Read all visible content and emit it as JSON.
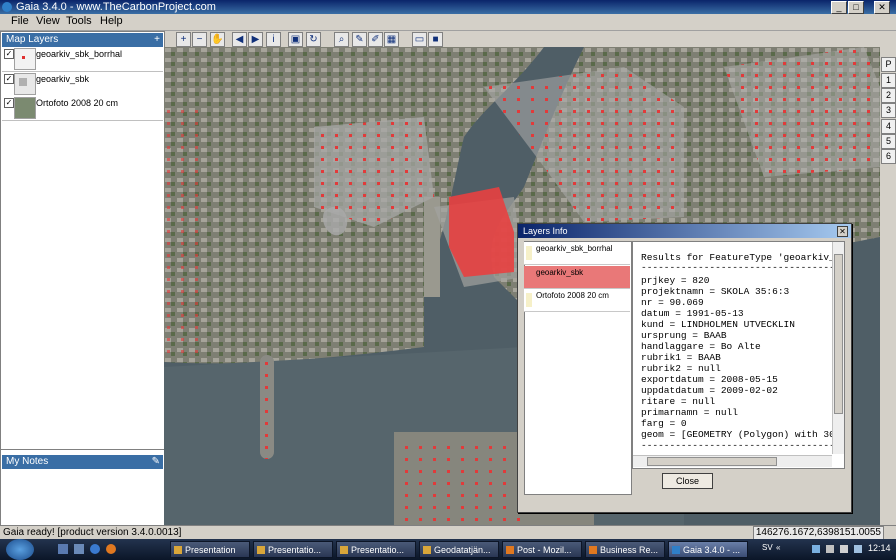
{
  "window": {
    "title": "Gaia 3.4.0 - www.TheCarbonProject.com"
  },
  "menu": [
    "File",
    "View",
    "Tools",
    "Help"
  ],
  "toolbar": {
    "icons": [
      "zoom-in-icon",
      "zoom-out-icon",
      "pan-icon",
      "back-icon",
      "forward-icon",
      "info-icon",
      "zoom-extent-icon",
      "refresh-icon",
      "select-icon",
      "edit-icon",
      "draw-icon",
      "table-icon",
      "open-folder-icon",
      "save-icon"
    ]
  },
  "map_layers": {
    "header": "Map Layers",
    "items": [
      {
        "label": "geoarkiv_sbk_borrhal",
        "checked": true
      },
      {
        "label": "geoarkiv_sbk",
        "checked": true
      },
      {
        "label": "Ortofoto 2008 20 cm",
        "checked": true
      }
    ]
  },
  "notes": {
    "header": "My Notes"
  },
  "scale_buttons": [
    "P",
    "1",
    "2",
    "3",
    "4",
    "5",
    "6"
  ],
  "dialog": {
    "title": "Layers Info",
    "layers": [
      "geoarkiv_sbk_borrhal",
      "geoarkiv_sbk",
      "Ortofoto 2008 20 cm"
    ],
    "selected_layer": "geoarkiv_sbk",
    "results": [
      "Results for FeatureType 'geoarkiv_s",
      "---------------------------------------",
      "prjkey = 820",
      "projektnamn = SKOLA 35:6:3",
      "nr = 90.069",
      "datum = 1991-05-13",
      "kund = LINDHOLMEN UTVECKLIN",
      "ursprung = BAAB",
      "handlaggare = Bo Alte",
      "rubrik1 = BAAB",
      "rubrik2 = null",
      "exportdatum = 2008-05-15",
      "uppdatdatum = 2009-02-02",
      "ritare = null",
      "primarnamn = null",
      "farg = 0",
      "geom = [GEOMETRY (Polygon) with 30",
      "---------------------------------------"
    ],
    "close_label": "Close"
  },
  "status": {
    "message": "Gaia ready! [product version 3.4.0.0013]",
    "coordinates": "146276.1672,6398151.0055"
  },
  "taskbar": {
    "tasks": [
      "Presentation",
      "Presentatio...",
      "Presentatio...",
      "Geodatatjän...",
      "Post - Mozil...",
      "Business Re...",
      "Gaia 3.4.0 - ..."
    ],
    "lang": "SV",
    "clock": "12:14"
  }
}
